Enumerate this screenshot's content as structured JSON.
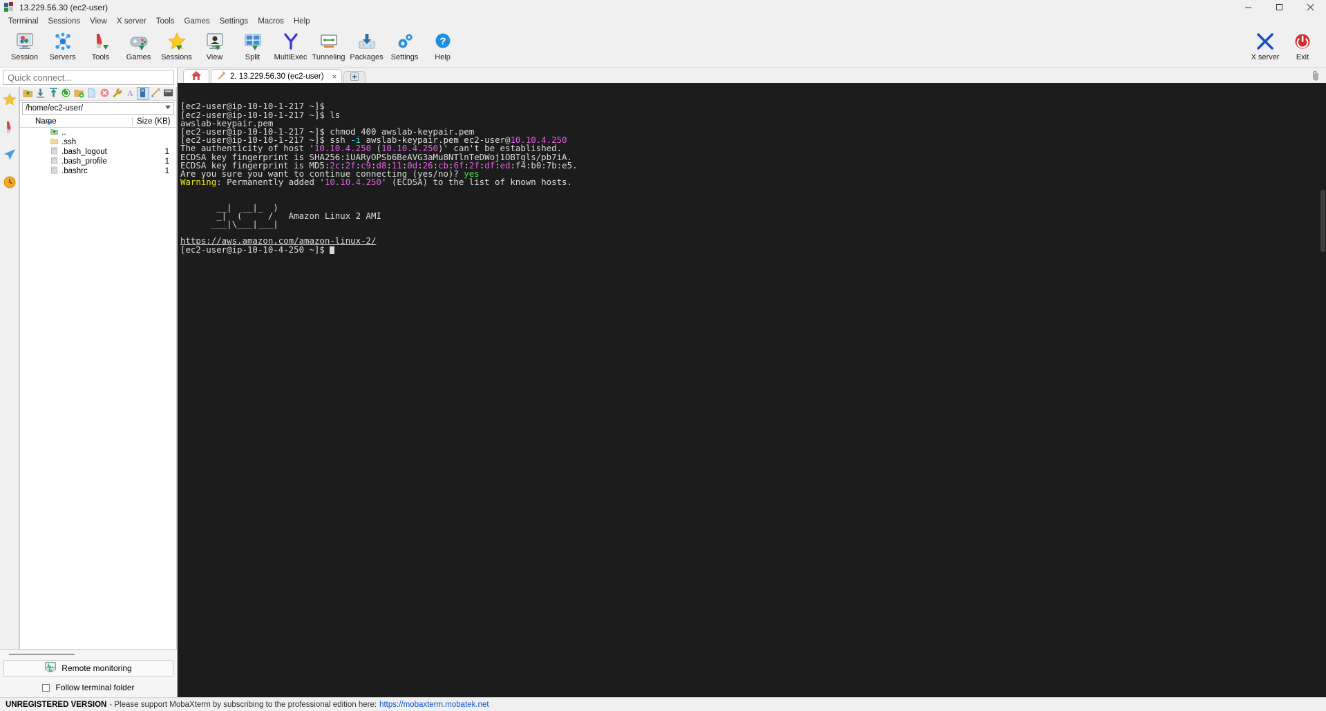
{
  "window": {
    "title": "13.229.56.30 (ec2-user)",
    "icon": "mobaxterm-logo-icon",
    "buttons": {
      "minimize": "–",
      "maximize": "□",
      "close": "×"
    }
  },
  "menubar": {
    "items": [
      "Terminal",
      "Sessions",
      "View",
      "X server",
      "Tools",
      "Games",
      "Settings",
      "Macros",
      "Help"
    ]
  },
  "toolbar": {
    "items": [
      {
        "label": "Session",
        "icon": "session-icon"
      },
      {
        "label": "Servers",
        "icon": "servers-icon"
      },
      {
        "label": "Tools",
        "icon": "tools-icon"
      },
      {
        "label": "Games",
        "icon": "games-gamepad-icon"
      },
      {
        "label": "Sessions",
        "icon": "sessions-star-icon"
      },
      {
        "label": "View",
        "icon": "view-monitor-icon"
      },
      {
        "label": "Split",
        "icon": "split-icon"
      },
      {
        "label": "MultiExec",
        "icon": "multiexec-icon"
      },
      {
        "label": "Tunneling",
        "icon": "tunneling-icon"
      },
      {
        "label": "Packages",
        "icon": "packages-download-icon"
      },
      {
        "label": "Settings",
        "icon": "settings-gear-icon"
      },
      {
        "label": "Help",
        "icon": "help-question-icon"
      }
    ],
    "right_items": [
      {
        "label": "X server",
        "icon": "x-server-icon"
      },
      {
        "label": "Exit",
        "icon": "exit-power-icon"
      }
    ]
  },
  "sidebar": {
    "quick_connect_placeholder": "Quick connect...",
    "side_tabs": [
      {
        "name": "sidebar-tab-sessions",
        "icon": "star-icon"
      },
      {
        "name": "sidebar-tab-tools",
        "icon": "swiss-knife-icon"
      },
      {
        "name": "sidebar-tab-macros",
        "icon": "paper-plane-icon"
      },
      {
        "name": "sidebar-tab-sftp",
        "icon": "clock-icon"
      }
    ],
    "sftp_toolbar": [
      {
        "name": "sftp-parent-folder-button",
        "icon": "up-folder-icon"
      },
      {
        "name": "sftp-download-button",
        "icon": "download-icon"
      },
      {
        "name": "sftp-upload-button",
        "icon": "upload-icon"
      },
      {
        "name": "sftp-refresh-button",
        "icon": "refresh-icon"
      },
      {
        "name": "sftp-new-folder-button",
        "icon": "new-folder-icon"
      },
      {
        "name": "sftp-new-file-button",
        "icon": "new-file-icon"
      },
      {
        "name": "sftp-delete-button",
        "icon": "delete-icon"
      },
      {
        "name": "sftp-permissions-button",
        "icon": "wrench-icon"
      },
      {
        "name": "sftp-text-mode-button",
        "icon": "font-a-icon"
      },
      {
        "name": "sftp-binary-mode-button",
        "icon": "binary-icon"
      },
      {
        "name": "sftp-compare-button",
        "icon": "compare-icon"
      },
      {
        "name": "sftp-terminal-button",
        "icon": "terminal-icon"
      }
    ],
    "path": "/home/ec2-user/",
    "columns": {
      "name": "Name",
      "size": "Size (KB)"
    },
    "files": [
      {
        "name": "..",
        "size": "",
        "icon": "parent-folder-icon"
      },
      {
        "name": ".ssh",
        "size": "",
        "icon": "folder-icon"
      },
      {
        "name": ".bash_logout",
        "size": "1",
        "icon": "file-icon"
      },
      {
        "name": ".bash_profile",
        "size": "1",
        "icon": "file-icon"
      },
      {
        "name": ".bashrc",
        "size": "1",
        "icon": "file-icon"
      }
    ],
    "remote_monitoring": "Remote monitoring",
    "follow_terminal_folder": "Follow terminal folder",
    "follow_terminal_folder_checked": false
  },
  "tabs": {
    "home_icon": "home-icon",
    "items": [
      {
        "label": "2. 13.229.56.30 (ec2-user)",
        "icon": "ssh-tab-icon",
        "close": "×",
        "active": true
      }
    ],
    "new_tab": "+",
    "clip_icon": "paperclip-icon"
  },
  "terminal": {
    "lines": [
      [
        {
          "t": "[ec2-user@ip-10-10-1-217 ~]$ ",
          "c": "def"
        }
      ],
      [
        {
          "t": "[ec2-user@ip-10-10-1-217 ~]$ ls",
          "c": "def"
        }
      ],
      [
        {
          "t": "awslab-keypair.pem",
          "c": "def"
        }
      ],
      [
        {
          "t": "[ec2-user@ip-10-10-1-217 ~]$ chmod 400 awslab-keypair.pem",
          "c": "def"
        }
      ],
      [
        {
          "t": "[ec2-user@ip-10-10-1-217 ~]$ ssh ",
          "c": "def"
        },
        {
          "t": "-i",
          "c": "cyan"
        },
        {
          "t": " awslab-keypair.pem ec2-user@",
          "c": "def"
        },
        {
          "t": "10.10.4.250",
          "c": "magenta"
        }
      ],
      [
        {
          "t": "The authenticity of host '",
          "c": "def"
        },
        {
          "t": "10.10.4.250",
          "c": "magenta"
        },
        {
          "t": " (",
          "c": "def"
        },
        {
          "t": "10.10.4.250",
          "c": "magenta"
        },
        {
          "t": ")' can't be established.",
          "c": "def"
        }
      ],
      [
        {
          "t": "ECDSA key fingerprint is SHA256:iUARyOPSb6BeAVG3aMu8NTlnTeDWoj1OBTgls/pb7iA.",
          "c": "def"
        }
      ],
      [
        {
          "t": "ECDSA key fingerprint is MD5:",
          "c": "def"
        },
        {
          "t": "2c",
          "c": "magenta"
        },
        {
          "t": ":",
          "c": "def"
        },
        {
          "t": "2f",
          "c": "magenta"
        },
        {
          "t": ":",
          "c": "def"
        },
        {
          "t": "c9",
          "c": "magenta"
        },
        {
          "t": ":",
          "c": "def"
        },
        {
          "t": "d8",
          "c": "magenta"
        },
        {
          "t": ":",
          "c": "def"
        },
        {
          "t": "11",
          "c": "magenta"
        },
        {
          "t": ":",
          "c": "def"
        },
        {
          "t": "0d",
          "c": "magenta"
        },
        {
          "t": ":",
          "c": "def"
        },
        {
          "t": "26",
          "c": "magenta"
        },
        {
          "t": ":",
          "c": "def"
        },
        {
          "t": "cb",
          "c": "magenta"
        },
        {
          "t": ":",
          "c": "def"
        },
        {
          "t": "6f",
          "c": "magenta"
        },
        {
          "t": ":",
          "c": "def"
        },
        {
          "t": "2f",
          "c": "magenta"
        },
        {
          "t": ":",
          "c": "def"
        },
        {
          "t": "df",
          "c": "magenta"
        },
        {
          "t": ":",
          "c": "def"
        },
        {
          "t": "ed",
          "c": "magenta"
        },
        {
          "t": ":f4:b0:7b:e5.",
          "c": "def"
        }
      ],
      [
        {
          "t": "Are you sure you want to continue connecting (yes/no)? ",
          "c": "def"
        },
        {
          "t": "yes",
          "c": "green"
        }
      ],
      [
        {
          "t": "Warning",
          "c": "yellow"
        },
        {
          "t": ": Permanently added '",
          "c": "def"
        },
        {
          "t": "10.10.4.250",
          "c": "magenta"
        },
        {
          "t": "' (ECDSA) to the list of known hosts.",
          "c": "def"
        }
      ],
      [
        {
          "t": "",
          "c": "def"
        }
      ],
      [
        {
          "t": "",
          "c": "def"
        }
      ],
      [
        {
          "t": "       __|  __|_  )",
          "c": "def"
        }
      ],
      [
        {
          "t": "       _|  (     /   Amazon Linux 2 AMI",
          "c": "def"
        }
      ],
      [
        {
          "t": "      ___|\\___|___|",
          "c": "def"
        }
      ],
      [
        {
          "t": "",
          "c": "def"
        }
      ],
      [
        {
          "t": "https://aws.amazon.com/amazon-linux-2/",
          "c": "link"
        }
      ],
      [
        {
          "t": "[ec2-user@ip-10-10-4-250 ~]$ ",
          "c": "def"
        },
        {
          "t": "█",
          "c": "cursor"
        }
      ]
    ]
  },
  "statusbar": {
    "unregistered": "UNREGISTERED VERSION",
    "message": "- Please support MobaXterm by subscribing to the professional edition here:",
    "link": "https://mobaxterm.mobatek.net"
  },
  "colors": {
    "terminal_bg": "#1c1c1c",
    "terminal_fg": "#dcdcdc",
    "magenta": "#e65fe6",
    "green": "#4ee44e",
    "cyan": "#3fd8d8",
    "yellow": "#e8e80f",
    "chrome_bg": "#f0f0f0",
    "link": "#1155cc"
  }
}
